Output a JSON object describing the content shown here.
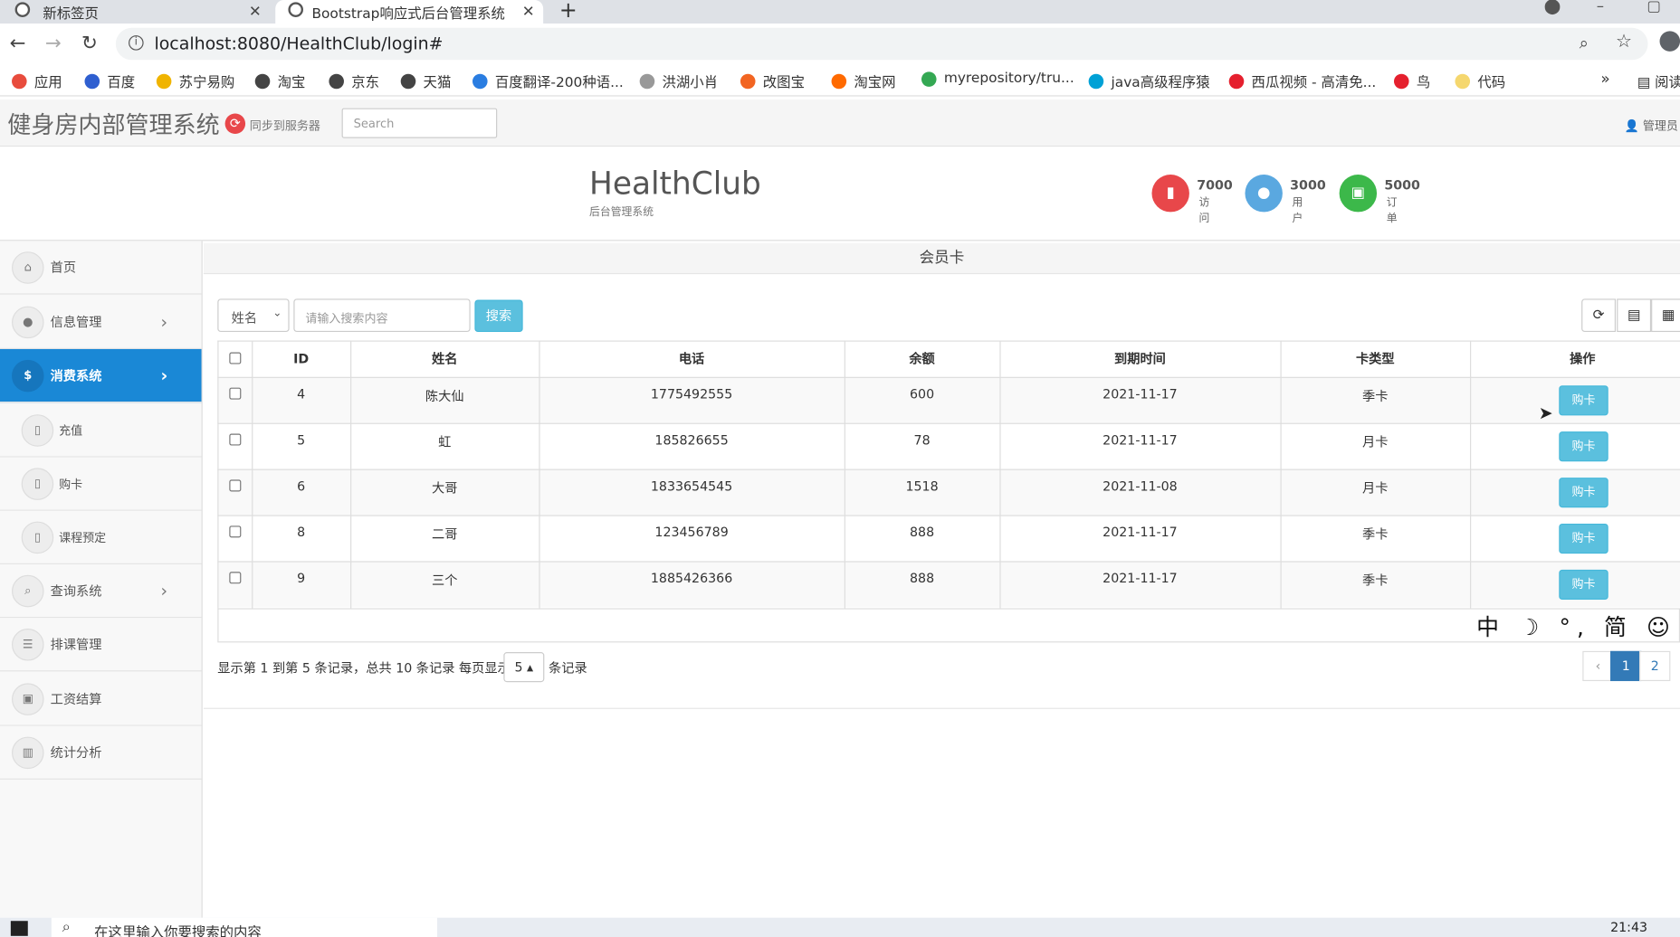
{
  "browser": {
    "tabs": [
      {
        "title": "新标签页"
      },
      {
        "title": "Bootstrap响应式后台管理系统"
      }
    ],
    "url": "localhost:8080/HealthClub/login#",
    "bookmarks": [
      {
        "label": "应用",
        "color": "#e84c3d"
      },
      {
        "label": "百度",
        "color": "#2f5fd0"
      },
      {
        "label": "苏宁易购",
        "color": "#f0b400"
      },
      {
        "label": "淘宝",
        "color": "#444444"
      },
      {
        "label": "京东",
        "color": "#444444"
      },
      {
        "label": "天猫",
        "color": "#444444"
      },
      {
        "label": "百度翻译-200种语...",
        "color": "#2a7de1"
      },
      {
        "label": "洪湖小肖",
        "color": "#999999"
      },
      {
        "label": "改图宝",
        "color": "#f26522"
      },
      {
        "label": "淘宝网",
        "color": "#ff6a00"
      },
      {
        "label": "myrepository/tru...",
        "color": "#34a853"
      },
      {
        "label": "java高级程序猿",
        "color": "#00a1d6"
      },
      {
        "label": "西瓜视频 - 高清免...",
        "color": "#e5202e"
      },
      {
        "label": "鸟",
        "color": "#e5202e"
      },
      {
        "label": "代码",
        "color": "#f5d76e"
      }
    ],
    "more": "»",
    "reading": "阅读"
  },
  "header": {
    "title": "健身房内部管理系统",
    "sync": "同步到服务器",
    "search_placeholder": "Search",
    "admin": "管理员"
  },
  "banner": {
    "brand": "HealthClub",
    "subtitle": "后台管理系统",
    "stats": [
      {
        "value": "7000",
        "label": "访问",
        "color": "#e8474a",
        "icon": "signal-icon"
      },
      {
        "value": "3000",
        "label": "用户",
        "color": "#5aa8e0",
        "icon": "user-icon"
      },
      {
        "value": "5000",
        "label": "订单",
        "color": "#3cb84a",
        "icon": "money-icon"
      }
    ]
  },
  "sidebar": {
    "items": [
      {
        "label": "首页",
        "icon": "home-icon"
      },
      {
        "label": "信息管理",
        "icon": "user-icon"
      },
      {
        "label": "消费系统",
        "icon": "dollar-icon"
      },
      {
        "label": "充值",
        "icon": "box-icon"
      },
      {
        "label": "购卡",
        "icon": "box-icon"
      },
      {
        "label": "课程预定",
        "icon": "box-icon"
      },
      {
        "label": "查询系统",
        "icon": "search-icon"
      },
      {
        "label": "排课管理",
        "icon": "list-icon"
      },
      {
        "label": "工资结算",
        "icon": "money-icon"
      },
      {
        "label": "统计分析",
        "icon": "chart-icon"
      }
    ]
  },
  "panel": {
    "title": "会员卡",
    "search_field": "姓名",
    "search_placeholder": "请输入搜索内容",
    "search_button": "搜索"
  },
  "table": {
    "columns": [
      "ID",
      "姓名",
      "电话",
      "余额",
      "到期时间",
      "卡类型",
      "操作"
    ],
    "action_label": "购卡",
    "rows": [
      {
        "id": "4",
        "name": "陈大仙",
        "phone": "1775492555",
        "balance": "600",
        "expire": "2021-11-17",
        "type": "季卡"
      },
      {
        "id": "5",
        "name": "虹",
        "phone": "185826655",
        "balance": "78",
        "expire": "2021-11-17",
        "type": "月卡"
      },
      {
        "id": "6",
        "name": "大哥",
        "phone": "1833654545",
        "balance": "1518",
        "expire": "2021-11-08",
        "type": "月卡"
      },
      {
        "id": "8",
        "name": "二哥",
        "phone": "123456789",
        "balance": "888",
        "expire": "2021-11-17",
        "type": "季卡"
      },
      {
        "id": "9",
        "name": "三个",
        "phone": "1885426366",
        "balance": "888",
        "expire": "2021-11-17",
        "type": "季卡"
      }
    ]
  },
  "pagination": {
    "info": "显示第 1 到第 5 条记录，总共 10 条记录 每页显示",
    "page_size": "5",
    "suffix": "条记录",
    "prev": "‹",
    "pages": [
      "1",
      "2"
    ]
  },
  "ime": "中 ☽ °, 简 ☺",
  "taskbar": {
    "search_placeholder": "在这里输入你要搜索的内容",
    "time": "21:43"
  }
}
